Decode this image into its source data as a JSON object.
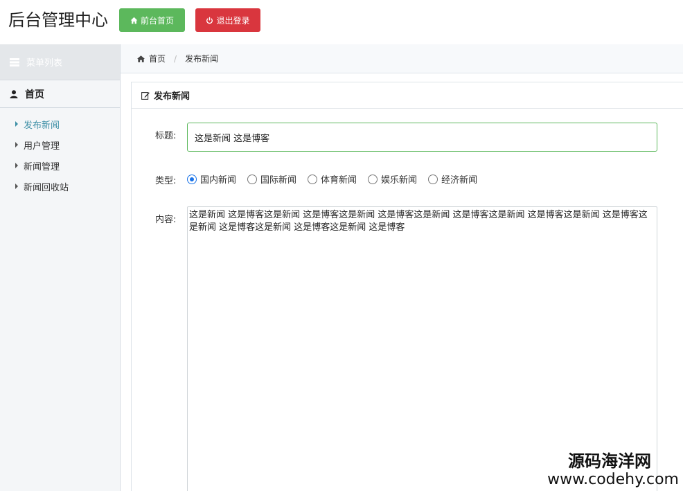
{
  "header": {
    "title": "后台管理中心",
    "home_button": "前台首页",
    "logout_button": "退出登录"
  },
  "sidebar": {
    "section_title": "菜单列表",
    "home_label": "首页",
    "items": [
      {
        "label": "发布新闻",
        "active": true
      },
      {
        "label": "用户管理",
        "active": false
      },
      {
        "label": "新闻管理",
        "active": false
      },
      {
        "label": "新闻回收站",
        "active": false
      }
    ]
  },
  "breadcrumb": {
    "home": "首页",
    "current": "发布新闻"
  },
  "panel": {
    "title": "发布新闻"
  },
  "form": {
    "title_label": "标题:",
    "title_value": "这是新闻 这是博客",
    "type_label": "类型:",
    "types": [
      "国内新闻",
      "国际新闻",
      "体育新闻",
      "娱乐新闻",
      "经济新闻"
    ],
    "selected_type": "国内新闻",
    "content_label": "内容:",
    "content_value": "这是新闻 这是博客这是新闻 这是博客这是新闻 这是博客这是新闻 这是博客这是新闻 这是博客这是新闻 这是博客这是新闻 这是博客这是新闻 这是博客这是新闻 这是博客"
  },
  "watermark": {
    "name": "源码海洋网",
    "url": "www.codehy.com"
  },
  "colors": {
    "success": "#5cb85c",
    "danger": "#d9363e",
    "active_link": "#3d8fa6",
    "radio_accent": "#1a73e8"
  }
}
